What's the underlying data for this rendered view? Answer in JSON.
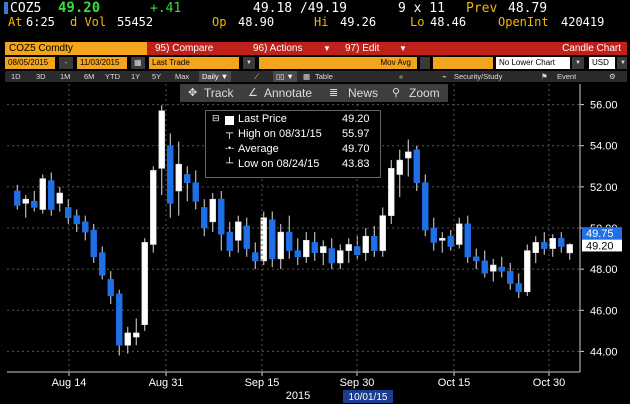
{
  "header": {
    "ticker": "COZ5",
    "last": "49.20",
    "change": "+.41",
    "bid_ask": "49.18 /49.19",
    "size": "9 x 11",
    "prev_label": "Prev",
    "prev": "48.79",
    "at_label": "At",
    "time": "6:25",
    "dvol_label": "d Vol",
    "dvol": "55452",
    "op_label": "Op",
    "open": "48.90",
    "hi_label": "Hi",
    "high": "49.26",
    "lo_label": "Lo",
    "low": "48.46",
    "oi_label": "OpenInt",
    "open_interest": "420419"
  },
  "menubar": {
    "security": "COZ5 Comdty",
    "compare": "95) Compare",
    "actions": "96) Actions",
    "edit": "97) Edit",
    "chart_type": "Candle Chart"
  },
  "controls": {
    "start_date": "08/05/2015",
    "end_date": "11/03/2015",
    "field": "Last Trade",
    "study": "Mov Avg",
    "lower": "No Lower Chart",
    "currency": "USD"
  },
  "toolbar": {
    "ranges": [
      "1D",
      "3D",
      "1M",
      "6M",
      "YTD",
      "1Y",
      "5Y",
      "Max"
    ],
    "frequency": "Daily",
    "table": "Table",
    "security_study": "Security/Study",
    "event": "Event"
  },
  "tools": {
    "track": "Track",
    "annotate": "Annotate",
    "news": "News",
    "zoom": "Zoom"
  },
  "legend": {
    "last_label": "Last Price",
    "last_value": "49.20",
    "high_label": "High on 08/31/15",
    "high_value": "55.97",
    "avg_label": "Average",
    "avg_value": "49.70",
    "low_label": "Low on 08/24/15",
    "low_value": "43.83"
  },
  "colors": {
    "up": "#ffffff",
    "down": "#1f6fe6",
    "accent": "#f2b700",
    "menubar": "#c0201a"
  },
  "chart_data": {
    "type": "candlestick",
    "ylim": [
      43,
      57
    ],
    "yticks": [
      "44.00",
      "46.00",
      "48.00",
      "50.00",
      "52.00",
      "54.00",
      "56.00"
    ],
    "xticks": [
      "Aug 14",
      "Aug 31",
      "Sep 15",
      "Sep 30",
      "Oct 15",
      "Oct 30"
    ],
    "year_label": "2015",
    "cursor_date": "10/01/15",
    "price_tags": [
      "49.75",
      "49.20"
    ],
    "ohlc": [
      [
        51.8,
        52.1,
        50.9,
        51.1
      ],
      [
        51.2,
        51.6,
        50.5,
        51.4
      ],
      [
        51.3,
        51.8,
        50.8,
        51.0
      ],
      [
        50.9,
        52.6,
        50.7,
        52.4
      ],
      [
        52.3,
        52.7,
        50.6,
        50.9
      ],
      [
        51.2,
        52.0,
        50.8,
        51.7
      ],
      [
        51.0,
        51.4,
        50.2,
        50.5
      ],
      [
        50.6,
        50.9,
        49.8,
        50.2
      ],
      [
        50.3,
        50.6,
        49.4,
        49.8
      ],
      [
        49.9,
        50.2,
        48.3,
        48.6
      ],
      [
        48.8,
        49.1,
        47.5,
        47.7
      ],
      [
        47.5,
        47.9,
        46.3,
        46.7
      ],
      [
        46.8,
        47.0,
        43.8,
        44.3
      ],
      [
        44.3,
        45.2,
        43.9,
        44.9
      ],
      [
        44.7,
        45.6,
        44.3,
        44.9
      ],
      [
        45.3,
        49.5,
        45.0,
        49.3
      ],
      [
        49.2,
        53.0,
        48.8,
        52.8
      ],
      [
        52.9,
        55.97,
        51.6,
        55.7
      ],
      [
        54.0,
        54.6,
        50.5,
        51.2
      ],
      [
        51.8,
        54.2,
        50.6,
        53.1
      ],
      [
        52.6,
        53.0,
        51.3,
        52.2
      ],
      [
        52.2,
        52.8,
        50.9,
        51.3
      ],
      [
        51.0,
        51.4,
        49.6,
        50.0
      ],
      [
        50.3,
        51.7,
        49.8,
        51.4
      ],
      [
        51.4,
        51.8,
        48.9,
        49.7
      ],
      [
        49.8,
        50.3,
        48.6,
        48.9
      ],
      [
        49.4,
        50.6,
        48.8,
        50.3
      ],
      [
        50.1,
        50.5,
        48.6,
        49.0
      ],
      [
        48.8,
        49.3,
        48.0,
        48.4
      ],
      [
        48.4,
        50.8,
        48.2,
        50.5
      ],
      [
        50.4,
        50.8,
        48.1,
        48.5
      ],
      [
        48.5,
        50.2,
        48.0,
        49.8
      ],
      [
        49.8,
        50.6,
        48.5,
        48.9
      ],
      [
        48.9,
        49.5,
        48.2,
        48.6
      ],
      [
        48.6,
        49.8,
        48.3,
        49.4
      ],
      [
        49.3,
        49.8,
        48.4,
        48.8
      ],
      [
        48.8,
        49.4,
        48.2,
        49.1
      ],
      [
        49.0,
        49.5,
        48.0,
        48.3
      ],
      [
        48.3,
        49.2,
        48.0,
        48.9
      ],
      [
        48.9,
        49.5,
        48.3,
        49.2
      ],
      [
        49.1,
        49.6,
        48.5,
        48.7
      ],
      [
        48.8,
        50.0,
        48.4,
        49.6
      ],
      [
        49.6,
        50.1,
        48.6,
        48.9
      ],
      [
        48.9,
        51.0,
        48.6,
        50.6
      ],
      [
        50.6,
        53.3,
        50.2,
        52.9
      ],
      [
        52.6,
        53.8,
        51.5,
        53.3
      ],
      [
        53.4,
        54.3,
        52.5,
        53.7
      ],
      [
        53.8,
        54.0,
        51.8,
        52.2
      ],
      [
        52.2,
        52.6,
        49.6,
        49.9
      ],
      [
        50.0,
        50.5,
        48.9,
        49.3
      ],
      [
        49.4,
        49.8,
        48.8,
        49.5
      ],
      [
        49.6,
        49.9,
        48.9,
        49.1
      ],
      [
        49.2,
        50.5,
        49.0,
        50.2
      ],
      [
        50.2,
        50.6,
        48.3,
        48.6
      ],
      [
        48.6,
        49.0,
        48.0,
        48.4
      ],
      [
        48.4,
        48.9,
        47.6,
        47.8
      ],
      [
        47.9,
        48.5,
        47.4,
        48.2
      ],
      [
        48.1,
        48.6,
        47.6,
        47.9
      ],
      [
        47.9,
        48.3,
        47.0,
        47.3
      ],
      [
        47.3,
        47.8,
        46.6,
        46.9
      ],
      [
        46.9,
        49.2,
        46.7,
        48.9
      ],
      [
        48.8,
        49.6,
        48.3,
        49.3
      ],
      [
        49.3,
        49.8,
        48.7,
        49.0
      ],
      [
        49.0,
        49.7,
        48.6,
        49.5
      ],
      [
        49.5,
        49.8,
        48.8,
        49.1
      ],
      [
        48.79,
        49.26,
        48.46,
        49.2
      ]
    ]
  }
}
